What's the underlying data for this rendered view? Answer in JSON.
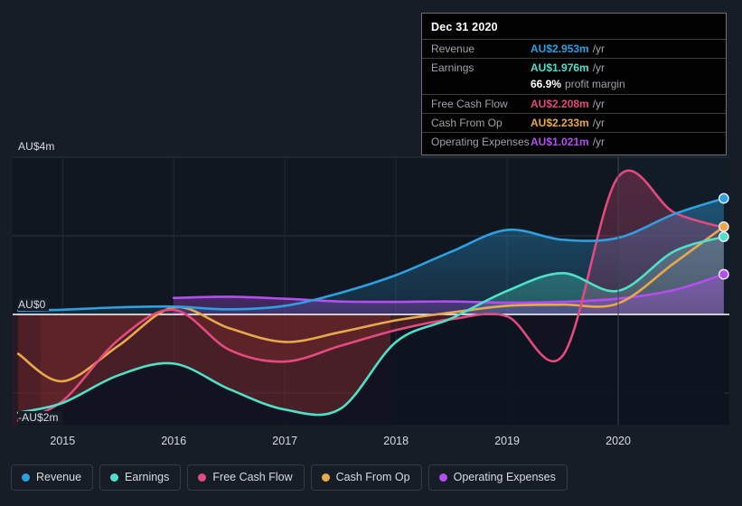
{
  "axes": {
    "y_ticks": [
      {
        "label": "AU$4m",
        "value": 4
      },
      {
        "label": "AU$0",
        "value": 0
      },
      {
        "label": "-AU$2m",
        "value": -2
      }
    ],
    "x_ticks": [
      "2015",
      "2016",
      "2017",
      "2018",
      "2019",
      "2020"
    ]
  },
  "tooltip": {
    "date": "Dec 31 2020",
    "rows": [
      {
        "label": "Revenue",
        "value": "AU$2.953m",
        "unit": "/yr",
        "color": "#2e9fe0"
      },
      {
        "label": "Earnings",
        "value": "AU$1.976m",
        "unit": "/yr",
        "color": "#4fe0c8"
      },
      {
        "label": "Free Cash Flow",
        "value": "AU$2.208m",
        "unit": "/yr",
        "color": "#e4497f"
      },
      {
        "label": "Cash From Op",
        "value": "AU$2.233m",
        "unit": "/yr",
        "color": "#e9a84b"
      },
      {
        "label": "Operating Expenses",
        "value": "AU$1.021m",
        "unit": "/yr",
        "color": "#b44ef0"
      }
    ],
    "margin": {
      "value": "66.9%",
      "label": "profit margin"
    }
  },
  "legend": [
    {
      "label": "Revenue",
      "color": "#2e9fe0"
    },
    {
      "label": "Earnings",
      "color": "#4fe0c8"
    },
    {
      "label": "Free Cash Flow",
      "color": "#e4497f"
    },
    {
      "label": "Cash From Op",
      "color": "#e9a84b"
    },
    {
      "label": "Operating Expenses",
      "color": "#b44ef0"
    }
  ],
  "chart_data": {
    "type": "area",
    "title": "",
    "xlabel": "",
    "ylabel": "AU$",
    "ylim": [
      -2.6,
      4.0
    ],
    "xlim": [
      "2014.5",
      "2021.0"
    ],
    "grid": true,
    "legend_position": "bottom",
    "currency": "AU$",
    "units": "millions per year",
    "x": [
      "2014.6",
      "2015.0",
      "2015.5",
      "2016.0",
      "2016.5",
      "2017.0",
      "2017.5",
      "2018.0",
      "2018.5",
      "2019.0",
      "2019.5",
      "2020.0",
      "2020.5",
      "2020.95"
    ],
    "series": [
      {
        "name": "Revenue",
        "color": "#2e9fe0",
        "values": [
          0.1,
          0.12,
          0.18,
          0.2,
          0.13,
          0.22,
          0.55,
          1.0,
          1.6,
          2.15,
          1.9,
          1.95,
          2.55,
          2.953
        ]
      },
      {
        "name": "Earnings",
        "color": "#4fe0c8",
        "values": [
          -2.5,
          -2.25,
          -1.55,
          -1.25,
          -1.9,
          -2.42,
          -2.4,
          -0.7,
          -0.1,
          0.6,
          1.05,
          0.6,
          1.6,
          1.976
        ]
      },
      {
        "name": "Free Cash Flow",
        "color": "#e4497f",
        "values": [
          -2.7,
          -2.2,
          -0.65,
          0.12,
          -0.9,
          -1.2,
          -0.8,
          -0.4,
          -0.12,
          -0.05,
          -1.05,
          3.5,
          2.6,
          2.208
        ]
      },
      {
        "name": "Cash From Op",
        "color": "#e9a84b",
        "values": [
          -1.0,
          -1.7,
          -0.8,
          0.18,
          -0.35,
          -0.7,
          -0.45,
          -0.15,
          0.05,
          0.22,
          0.25,
          0.28,
          1.3,
          2.233
        ]
      },
      {
        "name": "Operating Expenses",
        "color": "#b44ef0",
        "values": [
          null,
          null,
          null,
          0.42,
          0.45,
          0.4,
          0.33,
          0.32,
          0.33,
          0.3,
          0.32,
          0.4,
          0.62,
          1.021
        ]
      }
    ],
    "endpoint_markers": [
      {
        "series": "Revenue",
        "value": 2.953
      },
      {
        "series": "Cash From Op",
        "value": 2.233
      },
      {
        "series": "Earnings",
        "value": 1.976
      },
      {
        "series": "Operating Expenses",
        "value": 1.021
      }
    ]
  }
}
